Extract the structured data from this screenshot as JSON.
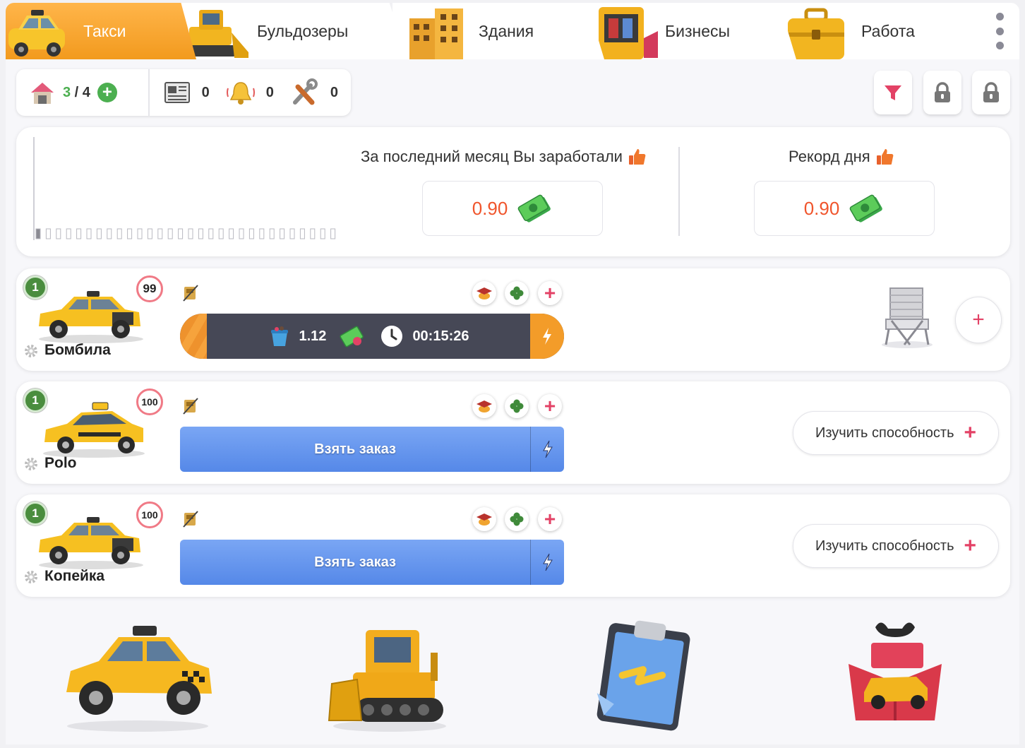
{
  "tabs": [
    {
      "label": "Такси",
      "active": true
    },
    {
      "label": "Бульдозеры",
      "active": false
    },
    {
      "label": "Здания",
      "active": false
    },
    {
      "label": "Бизнесы",
      "active": false
    },
    {
      "label": "Работа",
      "active": false
    }
  ],
  "stats": {
    "garage_used": "3",
    "garage_sep": " / ",
    "garage_total": "4",
    "newspaper_count": "0",
    "bell_count": "0",
    "repair_count": "0"
  },
  "earnings": {
    "month_title": "За последний месяц Вы заработали",
    "month_value": "0.90",
    "record_title": "Рекорд дня",
    "record_value": "0.90"
  },
  "vehicles": [
    {
      "name": "Бомбила",
      "level": "1",
      "condition": "99",
      "state": "working",
      "cargo_value": "1.12",
      "timer": "00:15:26",
      "idle_icon": "beach-chair"
    },
    {
      "name": "Polo",
      "level": "1",
      "condition": "100",
      "state": "idle",
      "order_label": "Взять заказ",
      "skill_label": "Изучить способность"
    },
    {
      "name": "Копейка",
      "level": "1",
      "condition": "100",
      "state": "idle",
      "order_label": "Взять заказ",
      "skill_label": "Изучить способность"
    }
  ],
  "bottom_icons": [
    "taxi-icon",
    "bulldozer-icon",
    "clipboard-icon",
    "gift-car-icon"
  ],
  "colors": {
    "accent_orange": "#f29a1e",
    "earn_value": "#f0552c",
    "order_blue": "#5a8be8",
    "plus_pink": "#e34266",
    "level_green": "#4a8d3e",
    "progress_dark": "#464856"
  }
}
